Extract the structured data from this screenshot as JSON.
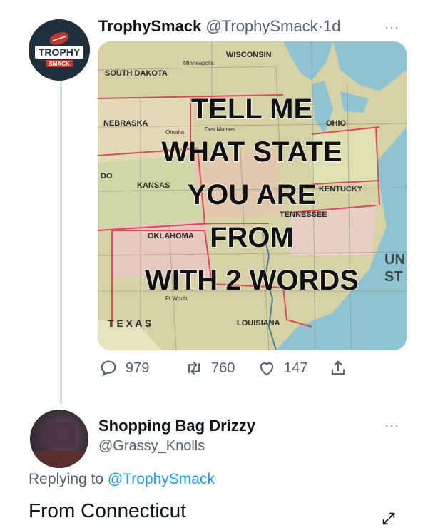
{
  "tweet": {
    "author_name": "TrophySmack",
    "author_handle": "@TrophySmack",
    "separator": "·",
    "time": "1d",
    "more_label": "···",
    "avatar": {
      "logo_top": "TROPHY",
      "logo_bottom": "SMACK"
    },
    "image": {
      "lines": [
        "TELL ME",
        "WHAT STATE",
        "YOU ARE",
        "FROM",
        "WITH 2 WORDS"
      ],
      "map_labels": [
        "WISCONSIN",
        "SOUTH DAKOTA",
        "NEBRASKA",
        "KANSAS",
        "OKLAHOMA",
        "T E X A S",
        "LOUISIANA",
        "TENNESSEE",
        "OHIO",
        "KENTUCKY",
        "UN",
        "ST",
        "DO",
        "Minneapolis",
        "Des Moines",
        "Omaha",
        "Ft Worth"
      ]
    },
    "stats": {
      "replies": "979",
      "retweets": "760",
      "likes": "147"
    }
  },
  "reply": {
    "author_name": "Shopping Bag Drizzy",
    "author_handle": "@Grassy_Knolls",
    "replying_prefix": "Replying to",
    "replying_to": "@TrophySmack",
    "text": "From Connecticut",
    "more_label": "···"
  },
  "colors": {
    "link": "#1d9bf0",
    "muted": "#536471",
    "map_water": "#8fc3d1",
    "map_land": "#d6d2a6"
  }
}
